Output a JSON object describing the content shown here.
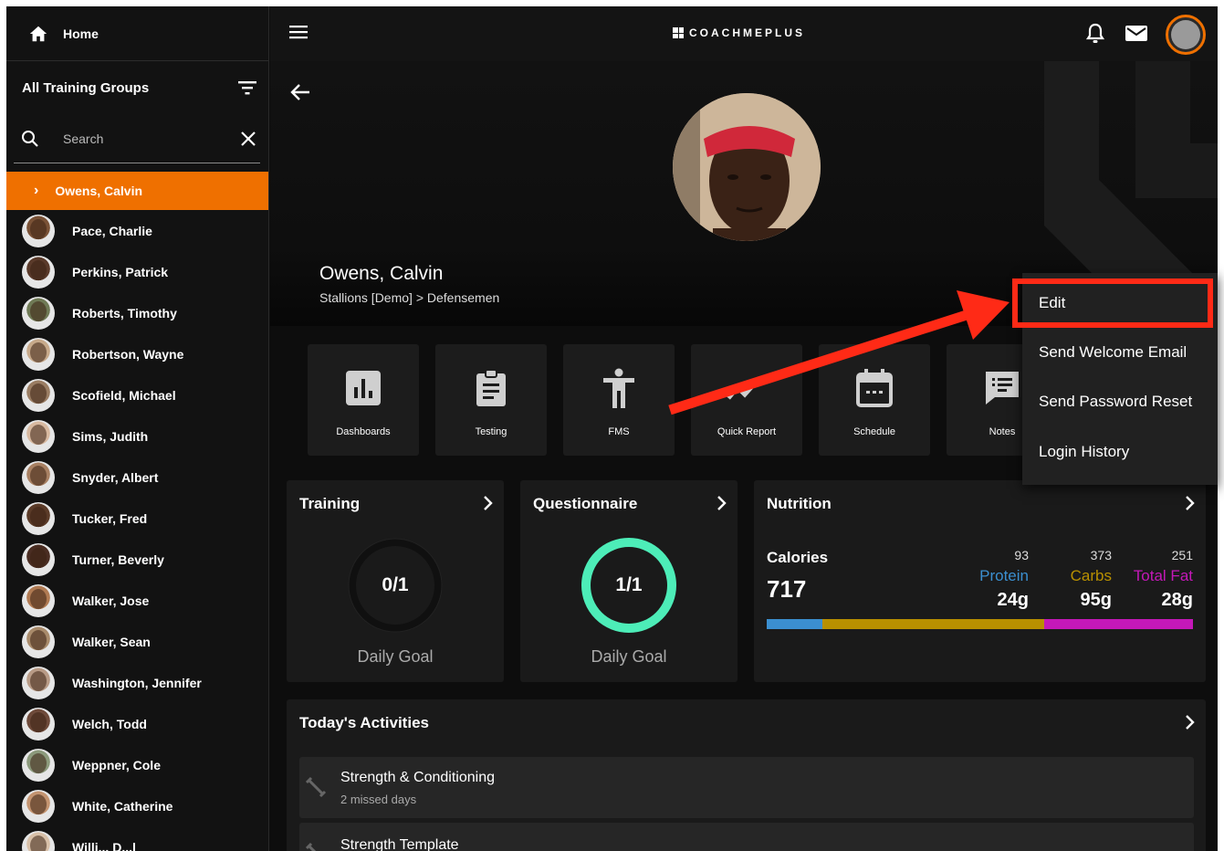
{
  "sidebar": {
    "home_label": "Home",
    "groups_label": "All Training Groups",
    "search_placeholder": "Search",
    "active_athlete": "Owens, Calvin",
    "athletes": [
      {
        "name": "Pace, Charlie",
        "tone": "#7a5236"
      },
      {
        "name": "Perkins, Patrick",
        "tone": "#5a3a2a"
      },
      {
        "name": "Roberts, Timothy",
        "tone": "#6f7a55"
      },
      {
        "name": "Robertson, Wayne",
        "tone": "#c7a98a"
      },
      {
        "name": "Scofield, Michael",
        "tone": "#9a7d63"
      },
      {
        "name": "Sims, Judith",
        "tone": "#d8b9a0"
      },
      {
        "name": "Snyder, Albert",
        "tone": "#a88062"
      },
      {
        "name": "Tucker, Fred",
        "tone": "#5b3b28"
      },
      {
        "name": "Turner, Beverly",
        "tone": "#4a2d22"
      },
      {
        "name": "Walker, Jose",
        "tone": "#b07a52"
      },
      {
        "name": "Walker, Sean",
        "tone": "#a98b6b"
      },
      {
        "name": "Washington, Jennifer",
        "tone": "#b89b86"
      },
      {
        "name": "Welch, Todd",
        "tone": "#6e4a3a"
      },
      {
        "name": "Weppner, Cole",
        "tone": "#8c9a7c"
      },
      {
        "name": "White, Catherine",
        "tone": "#c49470"
      },
      {
        "name": "Willi... D...l",
        "tone": "#d8c0a8"
      }
    ]
  },
  "topbar": {
    "logo_text": "COACHMEPLUS"
  },
  "profile": {
    "name": "Owens, Calvin",
    "team_path": "Stallions [Demo] > Defensemen"
  },
  "tiles": [
    {
      "label": "Dashboards",
      "icon": "bar-chart-icon"
    },
    {
      "label": "Testing",
      "icon": "clipboard-icon"
    },
    {
      "label": "FMS",
      "icon": "person-icon"
    },
    {
      "label": "Quick Report",
      "icon": "checkmark-chart-icon"
    },
    {
      "label": "Schedule",
      "icon": "calendar-icon"
    },
    {
      "label": "Notes",
      "icon": "notes-icon"
    }
  ],
  "training": {
    "title": "Training",
    "value": "0/1",
    "goal_label": "Daily Goal",
    "progress": 0
  },
  "questionnaire": {
    "title": "Questionnaire",
    "value": "1/1",
    "goal_label": "Daily Goal",
    "progress": 1
  },
  "nutrition": {
    "title": "Nutrition",
    "calories_label": "Calories",
    "calories_value": "717",
    "macros": [
      {
        "name": "Protein",
        "calories": "93",
        "grams": "24g",
        "color": "#3b8fd0",
        "share": 0.13
      },
      {
        "name": "Carbs",
        "calories": "373",
        "grams": "95g",
        "color": "#b89000",
        "share": 0.52
      },
      {
        "name": "Total Fat",
        "calories": "251",
        "grams": "28g",
        "color": "#c418b8",
        "share": 0.35
      }
    ]
  },
  "activities": {
    "title": "Today's Activities",
    "items": [
      {
        "title": "Strength & Conditioning",
        "subtitle": "2 missed days"
      },
      {
        "title": "Strength Template",
        "subtitle": ""
      }
    ]
  },
  "dropdown_menu": {
    "items": [
      "Edit",
      "Send Welcome Email",
      "Send Password Reset",
      "Login History"
    ],
    "highlighted": "Edit"
  },
  "colors": {
    "accent": "#ef7000",
    "ring_complete": "#4dedb8",
    "annotation": "#ff2a16"
  }
}
